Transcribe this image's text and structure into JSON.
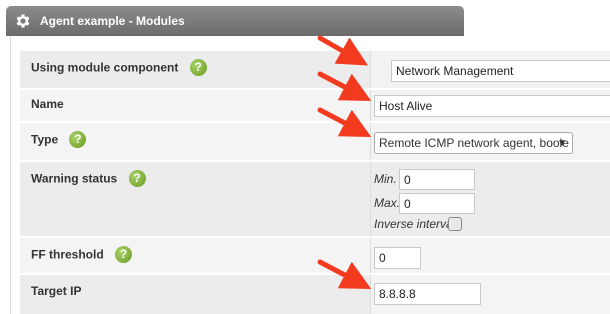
{
  "window": {
    "title": "Agent example - Modules"
  },
  "form": {
    "module_component": {
      "label": "Using module component",
      "value": "Network Management"
    },
    "name": {
      "label": "Name",
      "value": "Host Alive"
    },
    "type": {
      "label": "Type",
      "selected": "Remote ICMP network agent, boole"
    },
    "warning_status": {
      "label": "Warning status",
      "min_label": "Min.",
      "min_value": "0",
      "max_label": "Max.",
      "max_value": "0",
      "inverse_label": "Inverse interval"
    },
    "ff_threshold": {
      "label": "FF threshold",
      "value": "0"
    },
    "target_ip": {
      "label": "Target IP",
      "value": "8.8.8.8"
    }
  },
  "help_icon_glyph": "?",
  "colors": {
    "tab_bg": "#7a7a7a",
    "help_icon": "#7cae2c",
    "annotation_arrow": "#f23a1e"
  }
}
